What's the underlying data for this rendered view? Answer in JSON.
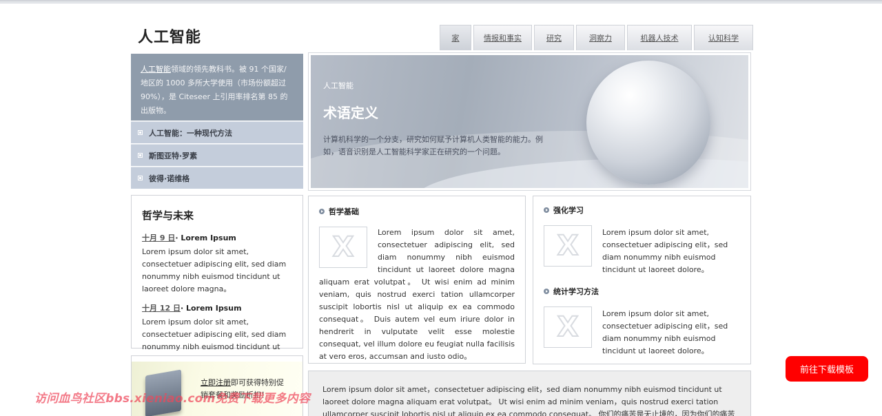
{
  "header": {
    "logo": "人工智能",
    "nav": [
      "家",
      "情报和事实",
      "研究",
      "洞察力",
      "机器人技术",
      "认知科学"
    ]
  },
  "sidebar": {
    "intro_lead": "人工智能",
    "intro_rest": "领域的领先教科书。被 91 个国家/地区的 1000 多所大学使用（市场份额超过 90%），是 Citeseer 上引用率排名第 85 的出版物。",
    "items": [
      "人工智能：一种现代方法",
      "斯图亚特·罗素",
      "彼得·诺维格"
    ]
  },
  "hero": {
    "small": "人工智能",
    "title": "术语定义",
    "text": "计算机科学的一个分支，研究如何赋予计算机人类智能的能力。例如，语音识别是人工智能科学家正在研究的一个问题。"
  },
  "philosophy": {
    "title": "哲学与未来",
    "news": [
      {
        "date": "十月 9 日",
        "headline": "· Lorem Ipsum",
        "body": "Lorem ipsum dolor sit amet, consectetuer adipiscing elit, sed diam nonummy nibh euismod tincidunt ut laoreet dolore magna。"
      },
      {
        "date": "十月 12 日",
        "headline": "· Lorem Ipsum",
        "body": "Lorem ipsum dolor sit amet, consectetuer adipiscing elit, sed diam nonummy nibh euismod tincidunt ut laoreet dolore magna。"
      }
    ]
  },
  "foundations": {
    "title": "哲学基础",
    "body": "Lorem ipsum dolor sit amet, consectetuer adipiscing elit, sed diam nonummy nibh euismod tincidunt ut laoreet dolore magna aliquam erat volutpat。 Ut wisi enim ad minim veniam, quis nostrud exerci tation ullamcorper suscipit lobortis nisl ut aliquip ex ea commodo consequat。 Duis autem vel eum iriure dolor in hendrerit in vulputate velit esse molestie consequat, vel illum dolore eu feugiat nulla facilisis at vero eros, accumsan and iusto odio。"
  },
  "right_sections": [
    {
      "title": "强化学习",
      "body": "Lorem ipsum dolor sit amet, consectetuer adipiscing elit，sed diam nonummy nibh euismod tincidunt ut laoreet dolore。"
    },
    {
      "title": "统计学习方法",
      "body": "Lorem ipsum dolor sit amet, consectetuer adipiscing elit，sed diam nonummy nibh euismod tincidunt ut laoreet dolore。"
    }
  ],
  "promo": {
    "link": "立即注册",
    "rest": "即可获得特别促销套餐和奖励折扣！"
  },
  "bottom_text": "Lorem ipsum dolor sit amet，consectetuer adipiscing elit，sed diam nonummy nibh euismod tincidunt ut laoreet dolore magna aliquam erat volutpat。 Ut wisi enim ad minim veniam，quis nostrud exerci tation ullamcorper suscipit lobortis nisl ut aliquip ex ea commodo consequat。 你们的痛苦是无止境的，因为你们的痛苦是无止境的，因为你们的痛苦是无止境的，因为你们的",
  "download_button": "前往下载模板",
  "watermark": "访问血鸟社区bbs.xieniao.com免费下载更多内容"
}
